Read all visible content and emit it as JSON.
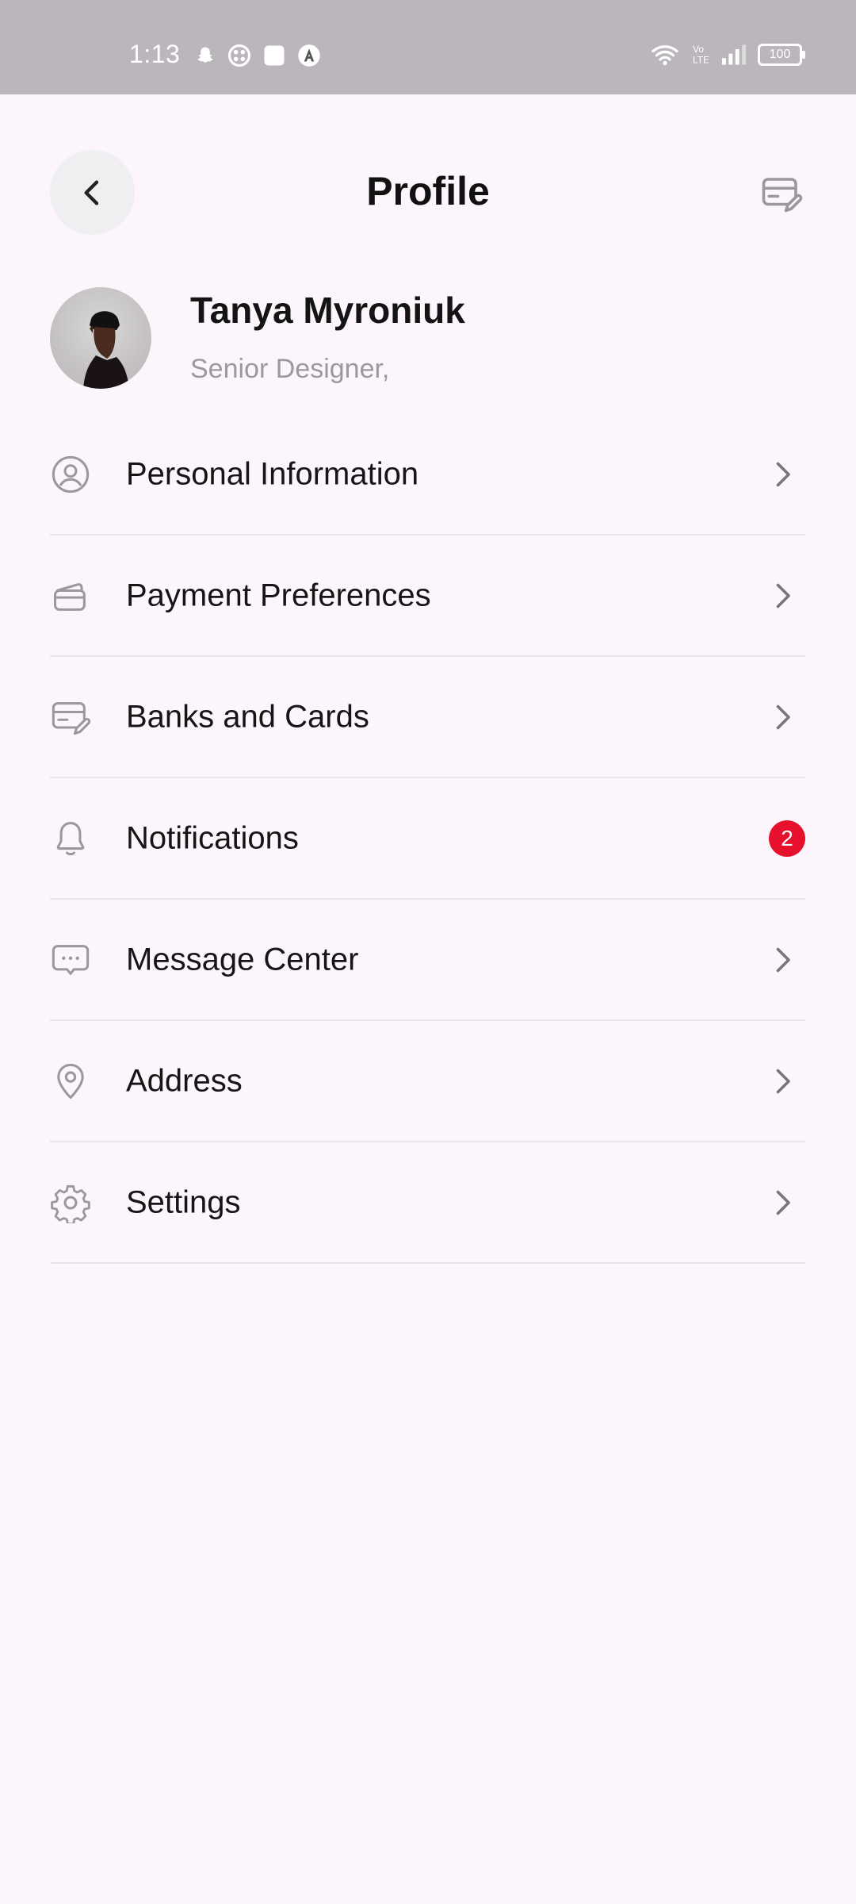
{
  "status_bar": {
    "time": "1:13",
    "battery": "100"
  },
  "header": {
    "title": "Profile"
  },
  "profile": {
    "name": "Tanya Myroniuk",
    "role": "Senior Designer,"
  },
  "menu": [
    {
      "label": "Personal Information",
      "icon": "user-circle-icon"
    },
    {
      "label": "Payment Preferences",
      "icon": "wallet-icon"
    },
    {
      "label": "Banks and Cards",
      "icon": "card-edit-icon"
    },
    {
      "label": "Notifications",
      "icon": "bell-icon",
      "badge": "2"
    },
    {
      "label": "Message Center",
      "icon": "message-icon"
    },
    {
      "label": "Address",
      "icon": "location-pin-icon"
    },
    {
      "label": "Settings",
      "icon": "gear-icon"
    }
  ],
  "colors": {
    "background": "#fcf6fc",
    "status_bar": "#bab6bb",
    "badge": "#e8112d",
    "icon_gray": "#9b979c"
  }
}
